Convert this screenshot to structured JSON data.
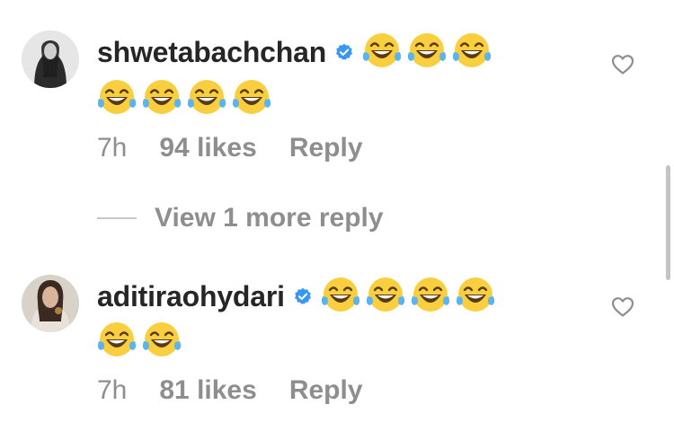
{
  "comments": [
    {
      "username": "shwetabachchan",
      "verified": true,
      "emoji_line1": [
        "😂",
        "😂",
        "😂"
      ],
      "emoji_line2": [
        "😂",
        "😂",
        "😂",
        "😂"
      ],
      "time": "7h",
      "likes": "94 likes",
      "reply_label": "Reply"
    },
    {
      "username": "aditiraohydari",
      "verified": true,
      "emoji_line1": [
        "😂",
        "😂",
        "😂",
        "😂"
      ],
      "emoji_line2": [
        "😂",
        "😂"
      ],
      "time": "7h",
      "likes": "81 likes",
      "reply_label": "Reply"
    }
  ],
  "view_replies_label": "View 1 more reply",
  "icons": {
    "verified": "verified-badge-icon",
    "heart": "heart-outline-icon",
    "emoji": "face-with-tears-of-joy-emoji"
  },
  "colors": {
    "username": "#262626",
    "meta": "#8e8e8e",
    "verified": "#3897f0",
    "emoji_face": "#f9cf3f",
    "emoji_tears": "#5ab4ef"
  }
}
